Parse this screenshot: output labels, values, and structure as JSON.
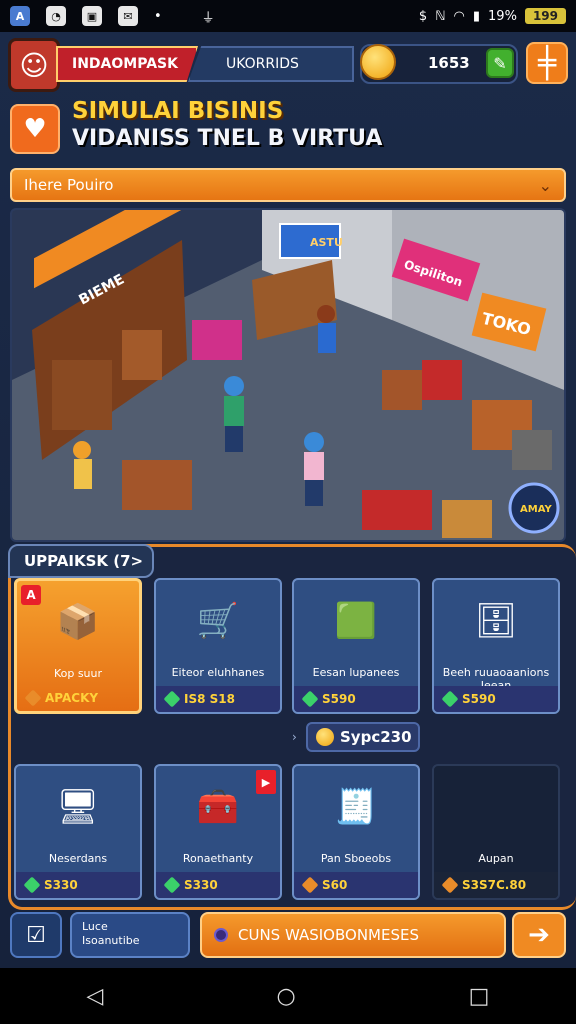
{
  "status_bar": {
    "battery_percent": "19%",
    "battery_label": "199",
    "left_icons": [
      "app-icon-a",
      "messenger-icon",
      "gallery-icon",
      "message-icon",
      "dot-icon",
      "usb-icon"
    ],
    "right_icons": [
      "dollar-icon",
      "mute-icon",
      "wifi-icon",
      "signal-icon"
    ]
  },
  "header": {
    "player_name": "INDAOMPASK",
    "mode_tab": "UKORRIDS",
    "coins": "1653",
    "add_coins_icon": "wrench-icon",
    "menu_icon": "plus-icon"
  },
  "title": {
    "line1": "SIMULAI BISINIS",
    "line2": "VIDANISS TNEL B VIRTUA",
    "icon": "heart-hand-icon"
  },
  "dropdown": {
    "label": "Ihere Pouiro"
  },
  "scene": {
    "signs": [
      "BIEME",
      "Ospiliton",
      "TOKO",
      "ASTU"
    ],
    "speech_bubble": "AMAY"
  },
  "shop": {
    "tab_label": "UPPAIKSK (7>",
    "cards": [
      {
        "name": "Kop suur",
        "price": "APACKY",
        "badge": "A",
        "selected": true
      },
      {
        "name": "Eiteor eluhhanes",
        "price": "IS8 S18"
      },
      {
        "name": "Eesan lupanees",
        "price": "S590"
      },
      {
        "name": "Beeh ruuaoaanions Ieean",
        "price": "S590"
      },
      {
        "name": "Neserdans",
        "price": "S330"
      },
      {
        "name": "Ronaethanty",
        "price": "S330",
        "ribbon": true
      },
      {
        "name": "Pan Sboeobs",
        "price": "S60"
      },
      {
        "name": "Aupan",
        "price": "S3S7C.80"
      }
    ],
    "coin_pill": "Sypc230"
  },
  "bottom_bar": {
    "location_line1": "Luce",
    "location_line2": "Isoanutibe",
    "action_label": "CUNS WASIOBONMESES",
    "next_icon": "arrow-right-icon"
  },
  "nav": [
    "back-icon",
    "home-icon",
    "recents-icon"
  ],
  "colors": {
    "accent": "#f08a22",
    "panel": "#1a2540",
    "coin": "#f0a20c",
    "danger": "#e8202a"
  }
}
